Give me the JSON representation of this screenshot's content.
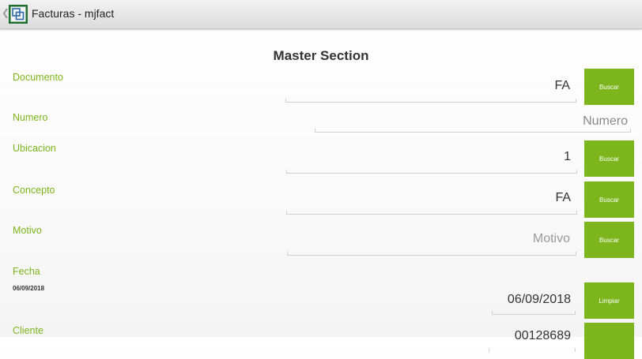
{
  "app": {
    "title": "Facturas - mjfact"
  },
  "section_title": "Master Section",
  "fields": {
    "documento": {
      "label": "Documento",
      "value": "FA",
      "button": "Buscar"
    },
    "numero": {
      "label": "Numero",
      "placeholder": "Numero"
    },
    "ubicacion": {
      "label": "Ubicacion",
      "value": "1",
      "button": "Buscar"
    },
    "concepto": {
      "label": "Concepto",
      "value": "FA",
      "button": "Buscar"
    },
    "motivo": {
      "label": "Motivo",
      "placeholder": "Motivo",
      "button": "Buscar"
    },
    "fecha": {
      "label": "Fecha",
      "sub_value": "06/09/2018",
      "value": "06/09/2018",
      "button": "Limpiar"
    },
    "cliente": {
      "label": "Cliente",
      "value": "00128689"
    }
  },
  "colors": {
    "accent": "#7cb51c",
    "text": "#333333",
    "hint": "#9a9a9a"
  }
}
